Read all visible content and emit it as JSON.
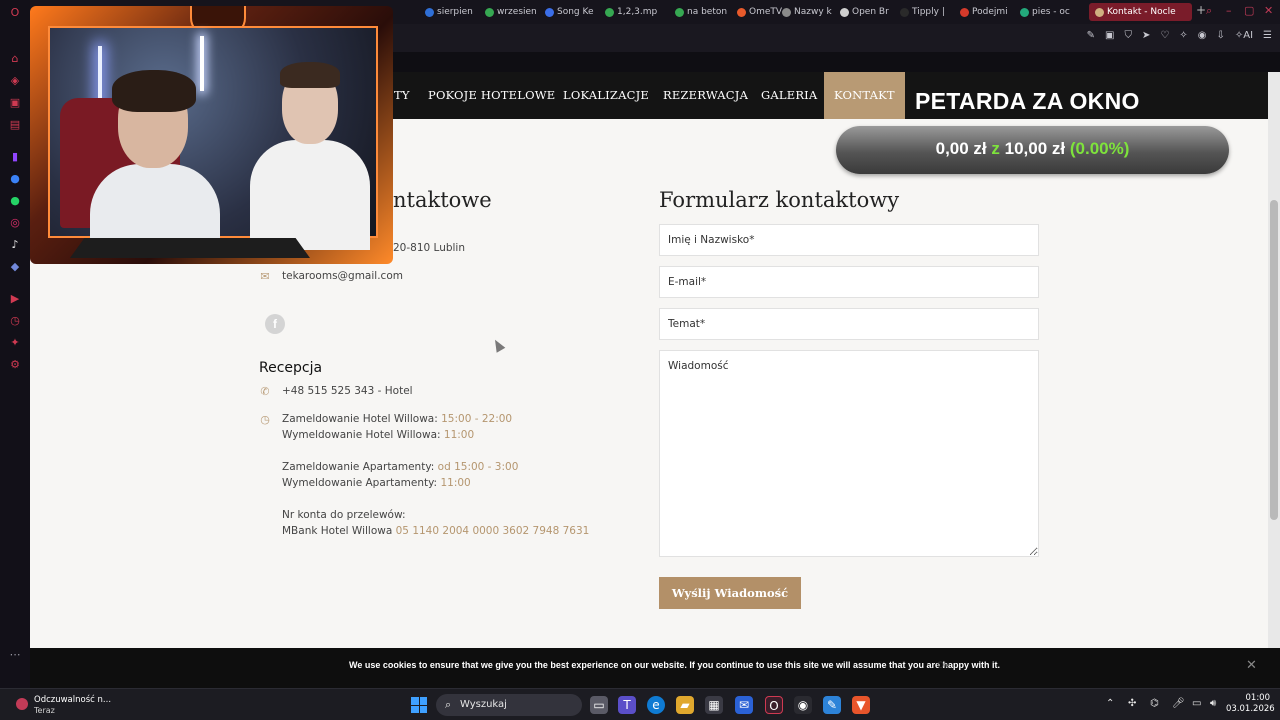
{
  "browser": {
    "tabs": [
      {
        "label": "sierpien",
        "color": "#2f6fd6"
      },
      {
        "label": "wrzesien",
        "color": "#36a852"
      },
      {
        "label": "Song Ke",
        "color": "#3b6ee8"
      },
      {
        "label": "1,2,3.mp",
        "color": "#36a852"
      },
      {
        "label": "na beton",
        "color": "#36a852"
      },
      {
        "label": "OmeTV",
        "color": "#e85a2b"
      },
      {
        "label": "Nazwy k",
        "color": "#8a8a8a"
      },
      {
        "label": "Open Br",
        "color": "#cfcfcf"
      },
      {
        "label": "Tipply |",
        "color": "#2a2a2a"
      },
      {
        "label": "Podejmi",
        "color": "#d43a2b"
      },
      {
        "label": "pies - oc",
        "color": "#23a97b"
      }
    ],
    "active_tab": "Kontakt - Nocle",
    "toolbar_ai_label": "AI"
  },
  "site_nav": {
    "items": [
      "TY",
      "POKOJE HOTELOWE",
      "LOKALIZACJE",
      "REZERWACJA",
      "GALERIA",
      "KONTAKT"
    ],
    "active": "KONTAKT"
  },
  "donation": {
    "title": "PETARDA ZA OKNO",
    "current": "0,00 zł",
    "separator": "z",
    "goal": "10,00 zł",
    "percent": "(0.00%)",
    "progress": 0.0
  },
  "contact": {
    "heading_partial": "ntaktowe",
    "address_partial": "20-810 Lublin",
    "email": "tekarooms@gmail.com",
    "reception_title": "Recepcja",
    "phone": "+48 515 525 343 - Hotel",
    "checkin_hotel_label": "Zameldowanie Hotel Willowa:",
    "checkin_hotel_value": "15:00 - 22:00",
    "checkout_hotel_label": "Wymeldowanie Hotel Willowa:",
    "checkout_hotel_value": "11:00",
    "checkin_apt_label": "Zameldowanie Apartamenty:",
    "checkin_apt_value": "od 15:00 - 3:00",
    "checkout_apt_label": "Wymeldowanie Apartamenty:",
    "checkout_apt_value": "11:00",
    "account_label": "Nr konta do przelewów:",
    "account_bank": "MBank Hotel Willowa",
    "account_number": "05 1140 2004 0000 3602 7948 7631"
  },
  "form": {
    "title": "Formularz kontaktowy",
    "name_placeholder": "Imię i Nazwisko*",
    "email_placeholder": "E-mail*",
    "subject_placeholder": "Temat*",
    "message_placeholder": "Wiadomość",
    "submit_label": "Wyślij Wiadomość"
  },
  "cookie_bar": {
    "text": "We use cookies to ensure that we give you the best experience on our website. If you continue to use this site we will assume that you are happy with it.",
    "ok_label": "Ok"
  },
  "taskbar": {
    "notification_title": "Odczuwalność n...",
    "notification_sub": "Teraz",
    "search_label": "Wyszukaj",
    "time": "01:00",
    "date": "03.01.2026"
  }
}
